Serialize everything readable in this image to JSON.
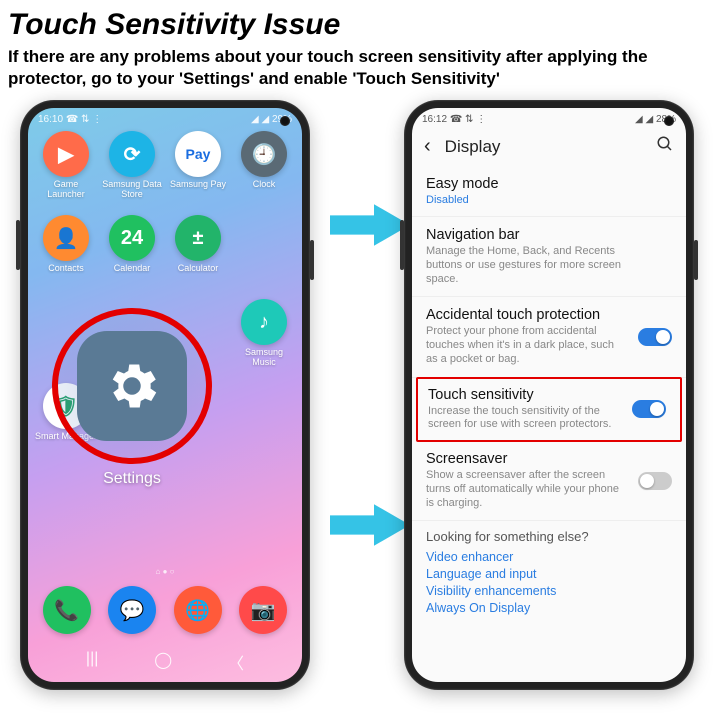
{
  "header": {
    "title": "Touch Sensitivity Issue",
    "subtitle": "If there are any problems about your touch screen sensitivity after applying the protector, go to your 'Settings' and enable 'Touch Sensitivity'"
  },
  "phone_left": {
    "time": "16:10",
    "status_icons": "☎ ⇅ ⋮",
    "signal": "◢ ◢ 29%",
    "apps": [
      {
        "label": "Game Launcher",
        "color": "#ff6b4a",
        "glyph": "▶"
      },
      {
        "label": "Samsung Data Store",
        "color": "#1db4e6",
        "glyph": "⟳"
      },
      {
        "label": "Samsung Pay",
        "color": "#ffffff",
        "glyph": "Pay",
        "tc": "#1a6de0"
      },
      {
        "label": "Clock",
        "color": "#5a6a75",
        "glyph": "🕘"
      },
      {
        "label": "Contacts",
        "color": "#ff8a30",
        "glyph": "👤"
      },
      {
        "label": "Calendar",
        "color": "#20c060",
        "glyph": "24",
        "tc": "#fff"
      },
      {
        "label": "Calculator",
        "color": "#22b46a",
        "glyph": "±"
      },
      {
        "label": "",
        "color": "",
        "glyph": ""
      },
      {
        "label": "",
        "color": "",
        "glyph": ""
      },
      {
        "label": "",
        "color": "",
        "glyph": ""
      },
      {
        "label": "",
        "color": "",
        "glyph": ""
      },
      {
        "label": "Samsung Music",
        "color": "#1ec9b8",
        "glyph": "♪"
      },
      {
        "label": "Smart Manager",
        "color": "#ffffff",
        "glyph": "🛡",
        "tc": "#18a060"
      }
    ],
    "settings_label": "Settings",
    "dock": [
      {
        "color": "#20c060",
        "glyph": "📞"
      },
      {
        "color": "#1a84f0",
        "glyph": "💬"
      },
      {
        "color": "#ff5a3a",
        "glyph": "🌐"
      },
      {
        "color": "#ff4a4a",
        "glyph": "📷"
      }
    ]
  },
  "phone_right": {
    "time": "16:12",
    "status_icons": "☎ ⇅ ⋮",
    "signal": "◢ ◢ 28%",
    "header_title": "Display",
    "rows": [
      {
        "title": "Easy mode",
        "status": "Disabled"
      },
      {
        "title": "Navigation bar",
        "desc": "Manage the Home, Back, and Recents buttons or use gestures for more screen space."
      },
      {
        "title": "Accidental touch protection",
        "desc": "Protect your phone from accidental touches when it's in a dark place, such as a pocket or bag.",
        "toggle": "on"
      },
      {
        "title": "Touch sensitivity",
        "desc": "Increase the touch sensitivity of the screen for use with screen protectors.",
        "toggle": "on",
        "highlight": true
      },
      {
        "title": "Screensaver",
        "desc": "Show a screensaver after the screen turns off automatically while your phone is charging.",
        "toggle": "off"
      }
    ],
    "footer_title": "Looking for something else?",
    "footer_links": [
      "Video enhancer",
      "Language and input",
      "Visibility enhancements",
      "Always On Display"
    ]
  }
}
